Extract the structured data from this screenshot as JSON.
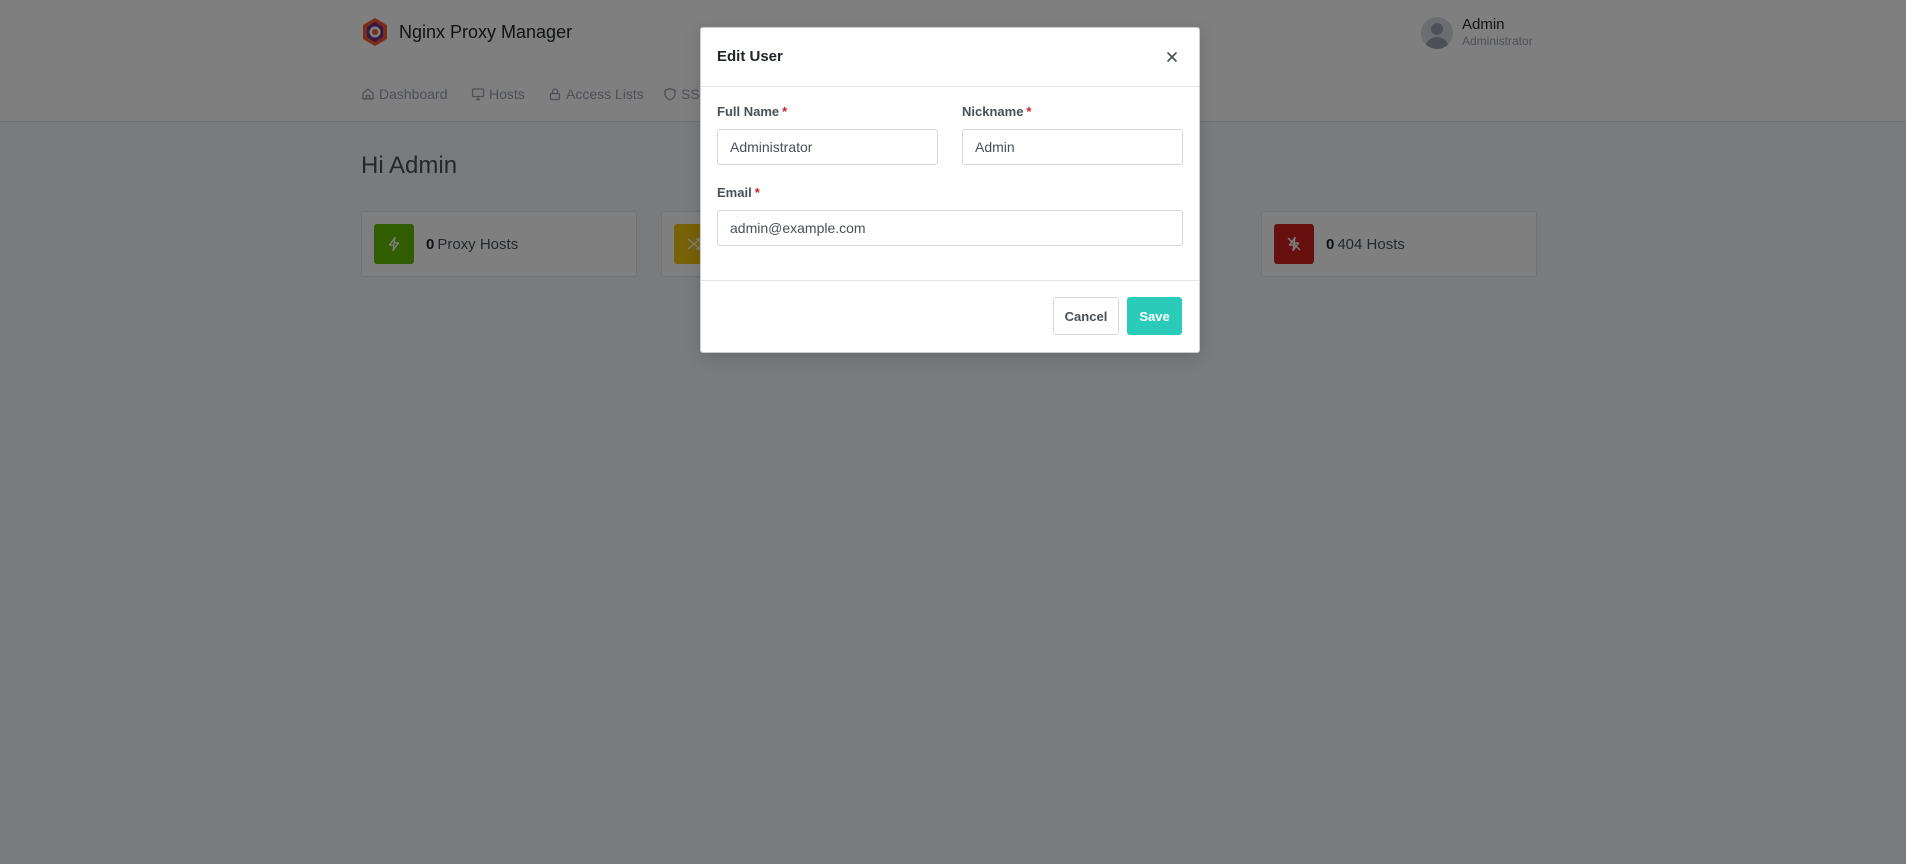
{
  "app": {
    "title": "Nginx Proxy Manager"
  },
  "user": {
    "name": "Admin",
    "role": "Administrator"
  },
  "nav": {
    "items": [
      {
        "label": "Dashboard",
        "icon": "home-icon"
      },
      {
        "label": "Hosts",
        "icon": "monitor-icon"
      },
      {
        "label": "Access Lists",
        "icon": "lock-icon"
      },
      {
        "label": "SSL",
        "icon": "shield-icon"
      }
    ]
  },
  "main": {
    "greeting": "Hi Admin",
    "cards": [
      {
        "count": "0",
        "label": "Proxy Hosts",
        "color": "#5eba00",
        "icon": "zap-icon"
      },
      {
        "count": "",
        "label": "",
        "color": "#f1c40f",
        "icon": "shuffle-icon"
      },
      {
        "count": "0",
        "label": "404 Hosts",
        "color": "#cd201f",
        "icon": "zap-off-icon"
      }
    ]
  },
  "modal": {
    "title": "Edit User",
    "fields": {
      "full_name": {
        "label": "Full Name",
        "required": "*",
        "value": "Administrator"
      },
      "nickname": {
        "label": "Nickname",
        "required": "*",
        "value": "Admin"
      },
      "email": {
        "label": "Email",
        "required": "*",
        "value": "admin@example.com"
      }
    },
    "buttons": {
      "cancel": "Cancel",
      "save": "Save"
    }
  },
  "colors": {
    "accent": "#2bcbba",
    "required": "#cd201f",
    "proxy_hosts": "#5eba00",
    "redirection_hosts": "#f1c40f",
    "dead_hosts": "#cd201f"
  }
}
